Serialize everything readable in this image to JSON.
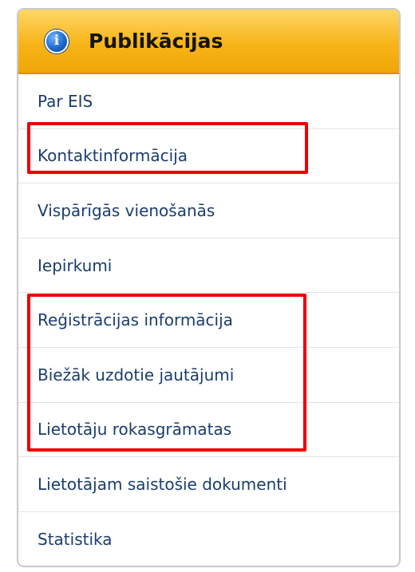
{
  "panel": {
    "title": "Publikācijas",
    "icon": "info-icon",
    "header_color": "#f7b418",
    "link_color": "#1a3d6e",
    "highlight_color": "#ee0000"
  },
  "menu": {
    "items": [
      {
        "label": "Par EIS"
      },
      {
        "label": "Kontaktinformācija"
      },
      {
        "label": "Vispārīgās vienošanās"
      },
      {
        "label": "Iepirkumi"
      },
      {
        "label": "Reģistrācijas informācija"
      },
      {
        "label": "Biežāk uzdotie jautājumi"
      },
      {
        "label": "Lietotāju rokasgrāmatas"
      },
      {
        "label": "Lietotājam saistošie dokumenti"
      },
      {
        "label": "Statistika"
      }
    ]
  }
}
